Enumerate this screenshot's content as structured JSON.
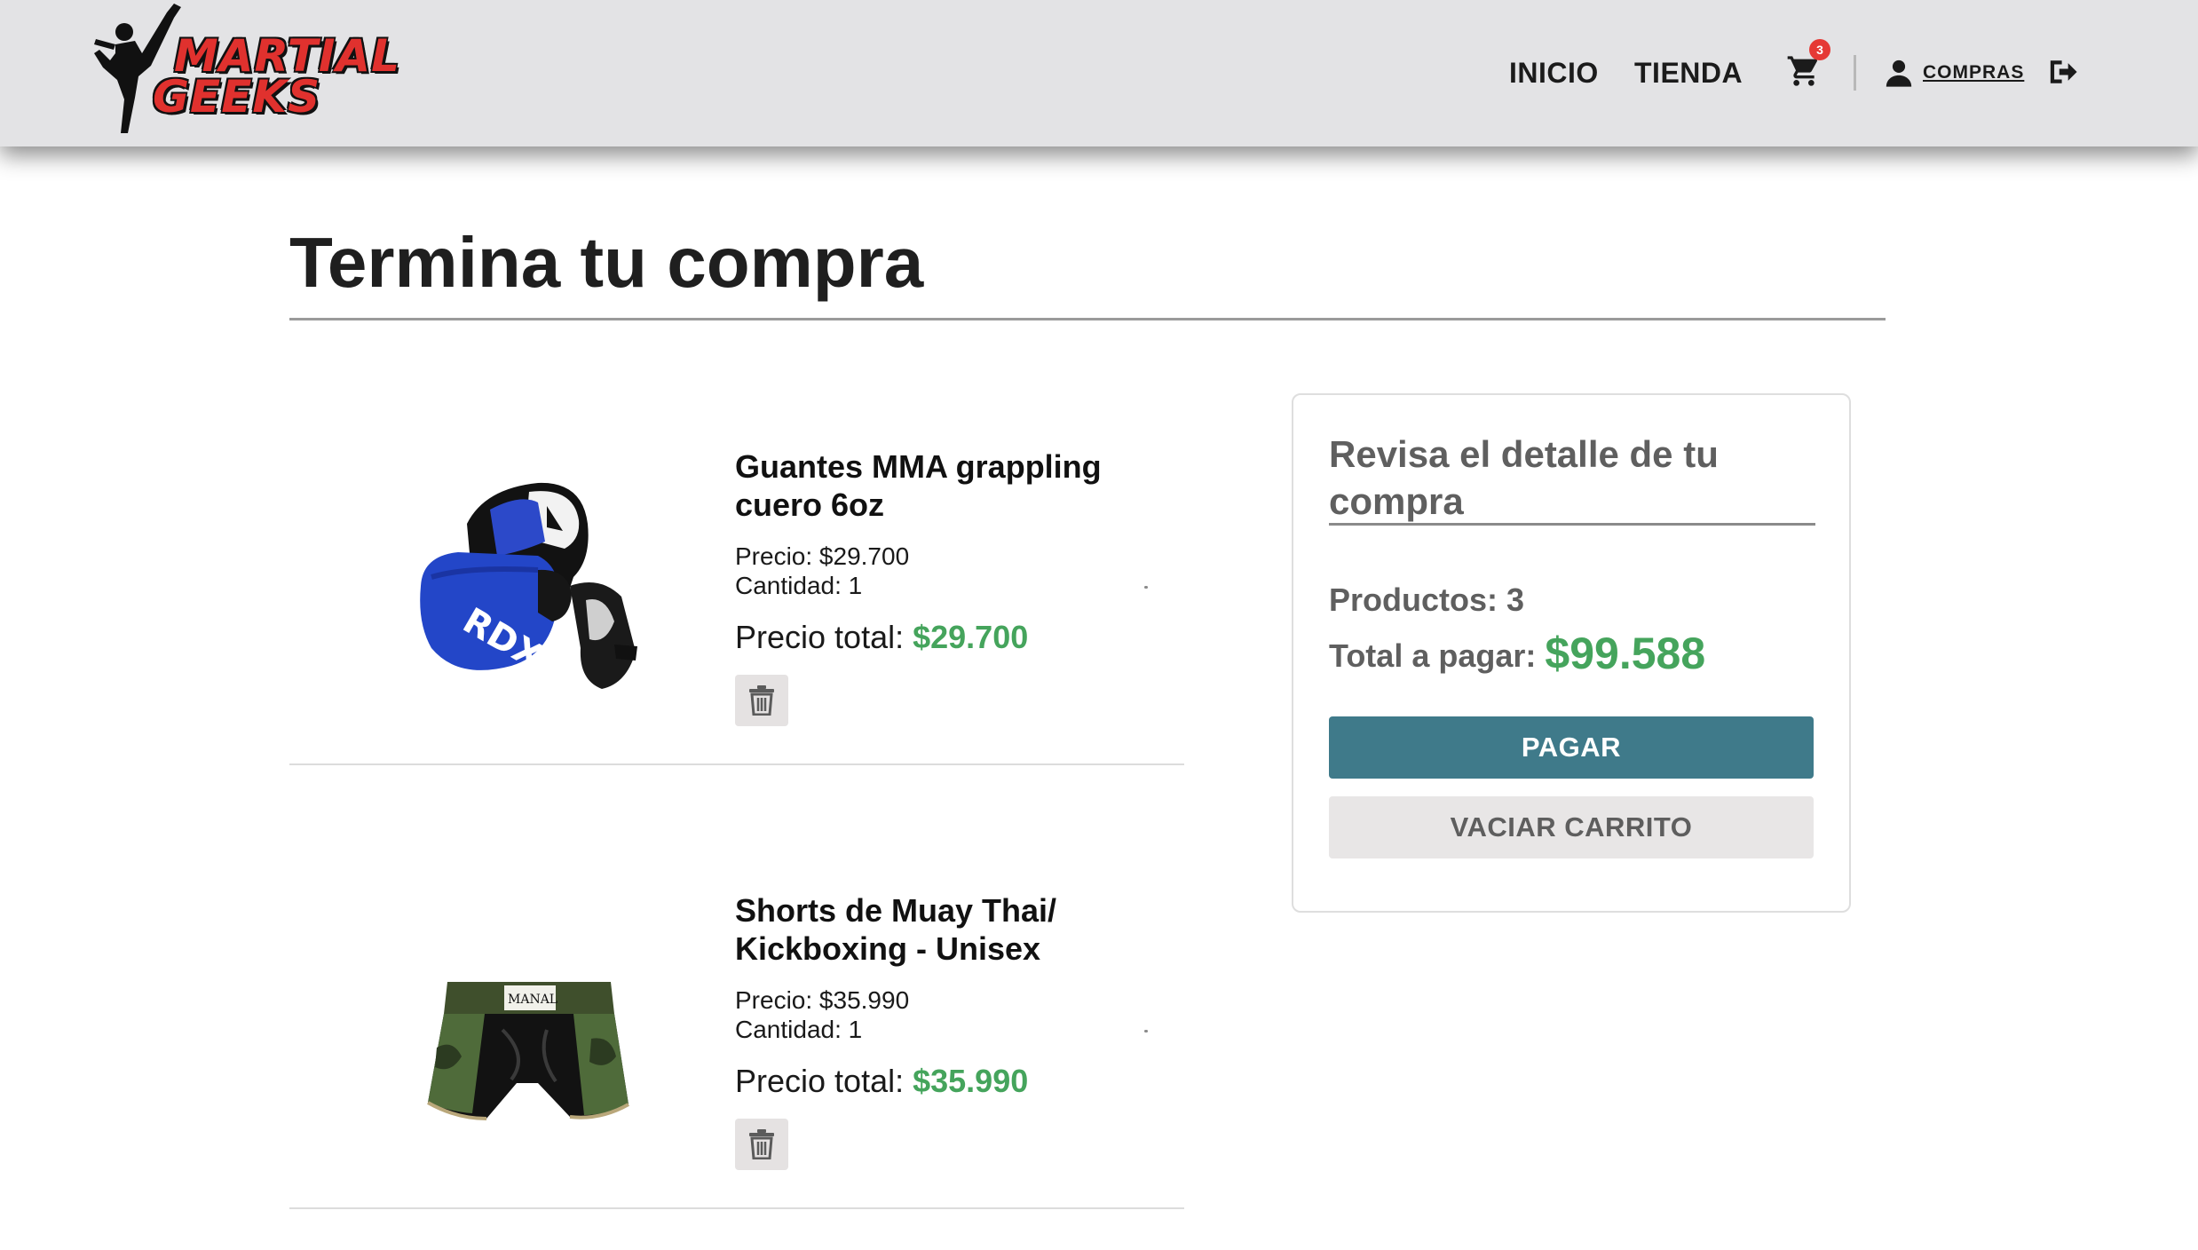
{
  "brand": {
    "line1": "MARTIAL",
    "line2": "GEEKS",
    "colors": {
      "red": "#e0312e",
      "black": "#111111"
    }
  },
  "nav": {
    "links": [
      "INICIO",
      "TIENDA"
    ],
    "cart_count": "3",
    "compras_label": "COMPRAS",
    "icons": [
      "cart-icon",
      "user-icon",
      "logout-icon"
    ]
  },
  "page": {
    "title": "Termina tu compra"
  },
  "cart_items": [
    {
      "name": "Guantes MMA grappling cuero 6oz",
      "price_label": "Precio: $29.700",
      "qty_label": "Cantidad: 1",
      "total_prefix": "Precio total:",
      "total_amount": "$29.700",
      "image": "mma-gloves-image"
    },
    {
      "name": "Shorts de Muay Thai/ Kickboxing - Unisex",
      "price_label": "Precio: $35.990",
      "qty_label": "Cantidad: 1",
      "total_prefix": "Precio total:",
      "total_amount": "$35.990",
      "image": "muay-thai-shorts-image"
    }
  ],
  "summary": {
    "title": "Revisa el detalle de tu compra",
    "products_label": "Productos: 3",
    "total_prefix": "Total a pagar:",
    "total_amount": "$99.588",
    "pay_button": "PAGAR",
    "empty_button": "VACIAR CARRITO"
  },
  "colors": {
    "navbar_bg": "#e3e3e5",
    "price_green": "#45a45c",
    "pay_button_bg": "#3f7a8a",
    "empty_button_bg": "#e8e6e6",
    "cart_badge": "#e53935"
  }
}
